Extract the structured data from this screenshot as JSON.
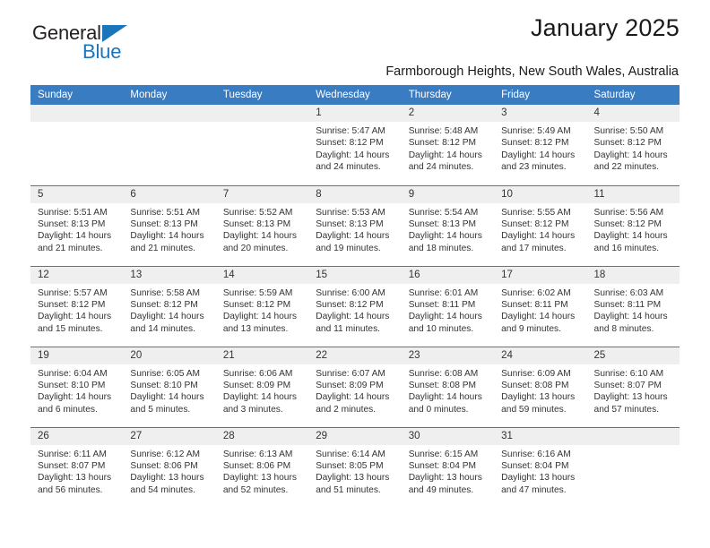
{
  "brand": {
    "name_part1": "General",
    "name_part2": "Blue",
    "accent_color": "#1b75bb"
  },
  "header": {
    "title": "January 2025",
    "subtitle": "Farmborough Heights, New South Wales, Australia"
  },
  "calendar": {
    "header_color": "#3a7cc2",
    "weekdays": [
      "Sunday",
      "Monday",
      "Tuesday",
      "Wednesday",
      "Thursday",
      "Friday",
      "Saturday"
    ],
    "weeks": [
      [
        {
          "date": "",
          "blank": true
        },
        {
          "date": "",
          "blank": true
        },
        {
          "date": "",
          "blank": true
        },
        {
          "date": "1",
          "sunrise": "Sunrise: 5:47 AM",
          "sunset": "Sunset: 8:12 PM",
          "daylight1": "Daylight: 14 hours",
          "daylight2": "and 24 minutes."
        },
        {
          "date": "2",
          "sunrise": "Sunrise: 5:48 AM",
          "sunset": "Sunset: 8:12 PM",
          "daylight1": "Daylight: 14 hours",
          "daylight2": "and 24 minutes."
        },
        {
          "date": "3",
          "sunrise": "Sunrise: 5:49 AM",
          "sunset": "Sunset: 8:12 PM",
          "daylight1": "Daylight: 14 hours",
          "daylight2": "and 23 minutes."
        },
        {
          "date": "4",
          "sunrise": "Sunrise: 5:50 AM",
          "sunset": "Sunset: 8:12 PM",
          "daylight1": "Daylight: 14 hours",
          "daylight2": "and 22 minutes."
        }
      ],
      [
        {
          "date": "5",
          "sunrise": "Sunrise: 5:51 AM",
          "sunset": "Sunset: 8:13 PM",
          "daylight1": "Daylight: 14 hours",
          "daylight2": "and 21 minutes."
        },
        {
          "date": "6",
          "sunrise": "Sunrise: 5:51 AM",
          "sunset": "Sunset: 8:13 PM",
          "daylight1": "Daylight: 14 hours",
          "daylight2": "and 21 minutes."
        },
        {
          "date": "7",
          "sunrise": "Sunrise: 5:52 AM",
          "sunset": "Sunset: 8:13 PM",
          "daylight1": "Daylight: 14 hours",
          "daylight2": "and 20 minutes."
        },
        {
          "date": "8",
          "sunrise": "Sunrise: 5:53 AM",
          "sunset": "Sunset: 8:13 PM",
          "daylight1": "Daylight: 14 hours",
          "daylight2": "and 19 minutes."
        },
        {
          "date": "9",
          "sunrise": "Sunrise: 5:54 AM",
          "sunset": "Sunset: 8:13 PM",
          "daylight1": "Daylight: 14 hours",
          "daylight2": "and 18 minutes."
        },
        {
          "date": "10",
          "sunrise": "Sunrise: 5:55 AM",
          "sunset": "Sunset: 8:12 PM",
          "daylight1": "Daylight: 14 hours",
          "daylight2": "and 17 minutes."
        },
        {
          "date": "11",
          "sunrise": "Sunrise: 5:56 AM",
          "sunset": "Sunset: 8:12 PM",
          "daylight1": "Daylight: 14 hours",
          "daylight2": "and 16 minutes."
        }
      ],
      [
        {
          "date": "12",
          "sunrise": "Sunrise: 5:57 AM",
          "sunset": "Sunset: 8:12 PM",
          "daylight1": "Daylight: 14 hours",
          "daylight2": "and 15 minutes."
        },
        {
          "date": "13",
          "sunrise": "Sunrise: 5:58 AM",
          "sunset": "Sunset: 8:12 PM",
          "daylight1": "Daylight: 14 hours",
          "daylight2": "and 14 minutes."
        },
        {
          "date": "14",
          "sunrise": "Sunrise: 5:59 AM",
          "sunset": "Sunset: 8:12 PM",
          "daylight1": "Daylight: 14 hours",
          "daylight2": "and 13 minutes."
        },
        {
          "date": "15",
          "sunrise": "Sunrise: 6:00 AM",
          "sunset": "Sunset: 8:12 PM",
          "daylight1": "Daylight: 14 hours",
          "daylight2": "and 11 minutes."
        },
        {
          "date": "16",
          "sunrise": "Sunrise: 6:01 AM",
          "sunset": "Sunset: 8:11 PM",
          "daylight1": "Daylight: 14 hours",
          "daylight2": "and 10 minutes."
        },
        {
          "date": "17",
          "sunrise": "Sunrise: 6:02 AM",
          "sunset": "Sunset: 8:11 PM",
          "daylight1": "Daylight: 14 hours",
          "daylight2": "and 9 minutes."
        },
        {
          "date": "18",
          "sunrise": "Sunrise: 6:03 AM",
          "sunset": "Sunset: 8:11 PM",
          "daylight1": "Daylight: 14 hours",
          "daylight2": "and 8 minutes."
        }
      ],
      [
        {
          "date": "19",
          "sunrise": "Sunrise: 6:04 AM",
          "sunset": "Sunset: 8:10 PM",
          "daylight1": "Daylight: 14 hours",
          "daylight2": "and 6 minutes."
        },
        {
          "date": "20",
          "sunrise": "Sunrise: 6:05 AM",
          "sunset": "Sunset: 8:10 PM",
          "daylight1": "Daylight: 14 hours",
          "daylight2": "and 5 minutes."
        },
        {
          "date": "21",
          "sunrise": "Sunrise: 6:06 AM",
          "sunset": "Sunset: 8:09 PM",
          "daylight1": "Daylight: 14 hours",
          "daylight2": "and 3 minutes."
        },
        {
          "date": "22",
          "sunrise": "Sunrise: 6:07 AM",
          "sunset": "Sunset: 8:09 PM",
          "daylight1": "Daylight: 14 hours",
          "daylight2": "and 2 minutes."
        },
        {
          "date": "23",
          "sunrise": "Sunrise: 6:08 AM",
          "sunset": "Sunset: 8:08 PM",
          "daylight1": "Daylight: 14 hours",
          "daylight2": "and 0 minutes."
        },
        {
          "date": "24",
          "sunrise": "Sunrise: 6:09 AM",
          "sunset": "Sunset: 8:08 PM",
          "daylight1": "Daylight: 13 hours",
          "daylight2": "and 59 minutes."
        },
        {
          "date": "25",
          "sunrise": "Sunrise: 6:10 AM",
          "sunset": "Sunset: 8:07 PM",
          "daylight1": "Daylight: 13 hours",
          "daylight2": "and 57 minutes."
        }
      ],
      [
        {
          "date": "26",
          "sunrise": "Sunrise: 6:11 AM",
          "sunset": "Sunset: 8:07 PM",
          "daylight1": "Daylight: 13 hours",
          "daylight2": "and 56 minutes."
        },
        {
          "date": "27",
          "sunrise": "Sunrise: 6:12 AM",
          "sunset": "Sunset: 8:06 PM",
          "daylight1": "Daylight: 13 hours",
          "daylight2": "and 54 minutes."
        },
        {
          "date": "28",
          "sunrise": "Sunrise: 6:13 AM",
          "sunset": "Sunset: 8:06 PM",
          "daylight1": "Daylight: 13 hours",
          "daylight2": "and 52 minutes."
        },
        {
          "date": "29",
          "sunrise": "Sunrise: 6:14 AM",
          "sunset": "Sunset: 8:05 PM",
          "daylight1": "Daylight: 13 hours",
          "daylight2": "and 51 minutes."
        },
        {
          "date": "30",
          "sunrise": "Sunrise: 6:15 AM",
          "sunset": "Sunset: 8:04 PM",
          "daylight1": "Daylight: 13 hours",
          "daylight2": "and 49 minutes."
        },
        {
          "date": "31",
          "sunrise": "Sunrise: 6:16 AM",
          "sunset": "Sunset: 8:04 PM",
          "daylight1": "Daylight: 13 hours",
          "daylight2": "and 47 minutes."
        },
        {
          "date": "",
          "blank": true
        }
      ]
    ]
  }
}
